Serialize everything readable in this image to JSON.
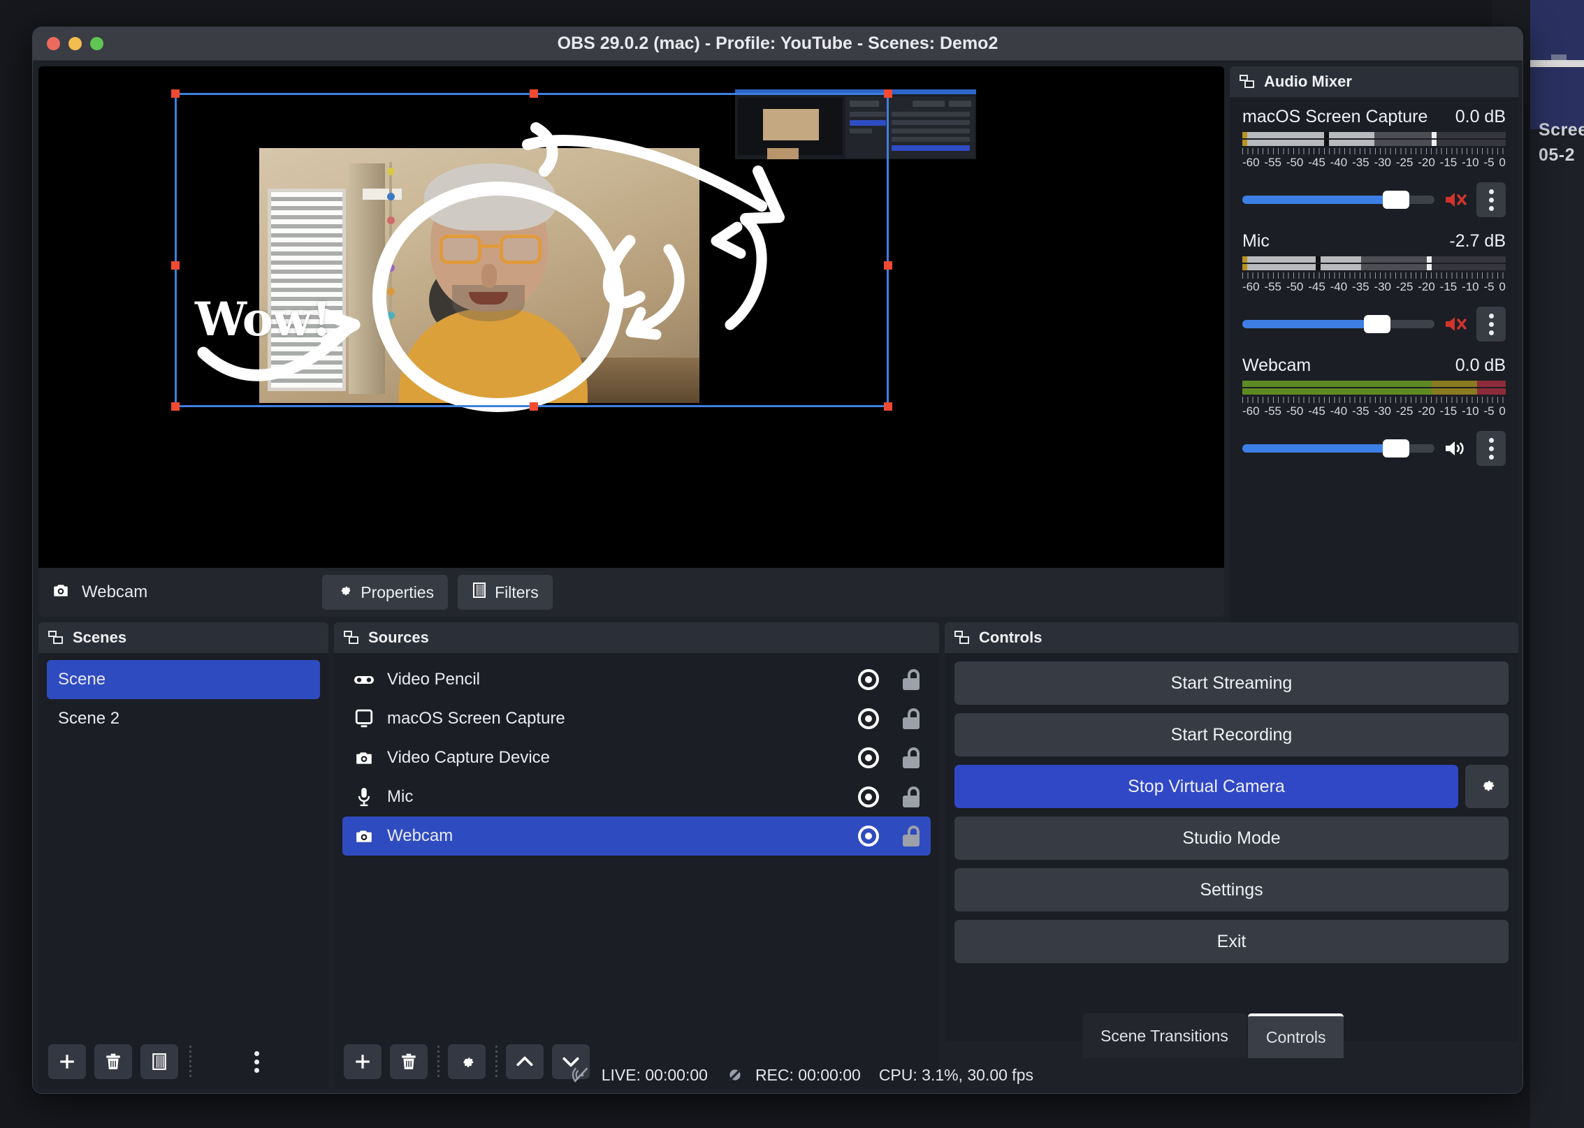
{
  "window": {
    "title": "OBS 29.0.2 (mac) - Profile: YouTube - Scenes: Demo2",
    "traffic_lights": [
      "close-red",
      "minimize-yellow",
      "maximize-green"
    ]
  },
  "preview": {
    "annotation_text": "Wow!",
    "selected_source_label": "Webcam",
    "properties_label": "Properties",
    "filters_label": "Filters",
    "source_icon": "camera-icon",
    "properties_icon": "gear-icon",
    "filters_icon": "filters-icon"
  },
  "audio_mixer": {
    "title": "Audio Mixer",
    "channels": [
      {
        "name": "macOS Screen Capture",
        "db": "0.0 dB",
        "muted": true,
        "active": false,
        "volume_pct": 80,
        "scale": [
          "-60",
          "-55",
          "-50",
          "-45",
          "-40",
          "-35",
          "-30",
          "-25",
          "-20",
          "-15",
          "-10",
          "-5",
          "0"
        ],
        "level_pct": 50,
        "peak_pct": 72
      },
      {
        "name": "Mic",
        "db": "-2.7 dB",
        "muted": true,
        "active": false,
        "volume_pct": 70,
        "scale": [
          "-60",
          "-55",
          "-50",
          "-45",
          "-40",
          "-35",
          "-30",
          "-25",
          "-20",
          "-15",
          "-10",
          "-5",
          "0"
        ],
        "level_pct": 45,
        "peak_pct": 70
      },
      {
        "name": "Webcam",
        "db": "0.0 dB",
        "muted": false,
        "active": true,
        "volume_pct": 80,
        "scale": [
          "-60",
          "-55",
          "-50",
          "-45",
          "-40",
          "-35",
          "-30",
          "-25",
          "-20",
          "-15",
          "-10",
          "-5",
          "0"
        ],
        "level_pct": 100,
        "peak_pct": 100
      }
    ],
    "footer": {
      "advanced_properties_icon": "double-gear-icon",
      "more_icon": "vertical-dots-icon"
    }
  },
  "scenes": {
    "title": "Scenes",
    "items": [
      {
        "label": "Scene",
        "selected": true
      },
      {
        "label": "Scene 2",
        "selected": false
      }
    ],
    "toolbar": [
      "add-icon",
      "remove-icon",
      "filters-icon",
      "vertical-dots-icon"
    ]
  },
  "sources": {
    "title": "Sources",
    "items": [
      {
        "label": "Video Pencil",
        "icon": "gamepad-icon",
        "visible": true,
        "locked": false,
        "selected": false
      },
      {
        "label": "macOS Screen Capture",
        "icon": "monitor-icon",
        "visible": true,
        "locked": false,
        "selected": false
      },
      {
        "label": "Video Capture Device",
        "icon": "camera-icon",
        "visible": true,
        "locked": false,
        "selected": false
      },
      {
        "label": "Mic",
        "icon": "microphone-icon",
        "visible": true,
        "locked": false,
        "selected": false
      },
      {
        "label": "Webcam",
        "icon": "camera-icon",
        "visible": true,
        "locked": false,
        "selected": true
      }
    ],
    "toolbar": [
      "add-icon",
      "remove-icon",
      "gear-icon",
      "move-up-icon",
      "move-down-icon"
    ]
  },
  "controls": {
    "title": "Controls",
    "buttons": [
      {
        "label": "Start Streaming",
        "primary": false
      },
      {
        "label": "Start Recording",
        "primary": false
      },
      {
        "label": "Stop Virtual Camera",
        "primary": true,
        "has_gear": true
      },
      {
        "label": "Studio Mode",
        "primary": false
      },
      {
        "label": "Settings",
        "primary": false
      },
      {
        "label": "Exit",
        "primary": false
      }
    ]
  },
  "dock_tabs": [
    {
      "label": "Scene Transitions",
      "active": false
    },
    {
      "label": "Controls",
      "active": true
    }
  ],
  "status_bar": {
    "live": "LIVE: 00:00:00",
    "rec": "REC: 00:00:00",
    "cpu": "CPU: 3.1%, 30.00 fps",
    "live_icon": "broadcast-off-icon",
    "rec_icon": "record-off-icon"
  },
  "desktop": {
    "label_line1": "Scree",
    "label_line2": "05-2"
  },
  "colors": {
    "accent_blue": "#2f4bc0",
    "selection_border": "#3f7fe0",
    "handle_red": "#f04a32",
    "fader_blue": "#3d7fe4",
    "panel_bg": "#1b1e24",
    "window_bg": "#1e2127",
    "header_bg": "#2b2f37",
    "button_bg": "#373b44"
  }
}
